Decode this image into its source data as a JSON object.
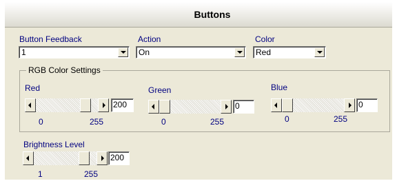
{
  "title": "Buttons",
  "fields": {
    "button_feedback": {
      "label": "Button Feedback",
      "value": "1"
    },
    "action": {
      "label": "Action",
      "value": "On"
    },
    "color": {
      "label": "Color",
      "value": "Red"
    }
  },
  "rgb_group": {
    "title": "RGB Color Settings",
    "red": {
      "label": "Red",
      "value": "200",
      "min": "0",
      "max": "255",
      "level": 0.78
    },
    "green": {
      "label": "Green",
      "value": "0",
      "min": "0",
      "max": "255",
      "level": 0.0
    },
    "blue": {
      "label": "Blue",
      "value": "0",
      "min": "0",
      "max": "255",
      "level": 0.0
    }
  },
  "brightness": {
    "label": "Brightness Level",
    "value": "200",
    "min": "1",
    "max": "255",
    "level": 0.78
  },
  "icons": {
    "dropdown": "chevron-down-icon",
    "scroll_left": "arrow-left-icon",
    "scroll_right": "arrow-right-icon"
  },
  "colors": {
    "label_text": "#000080",
    "panel_bg": "#ece9d8"
  }
}
